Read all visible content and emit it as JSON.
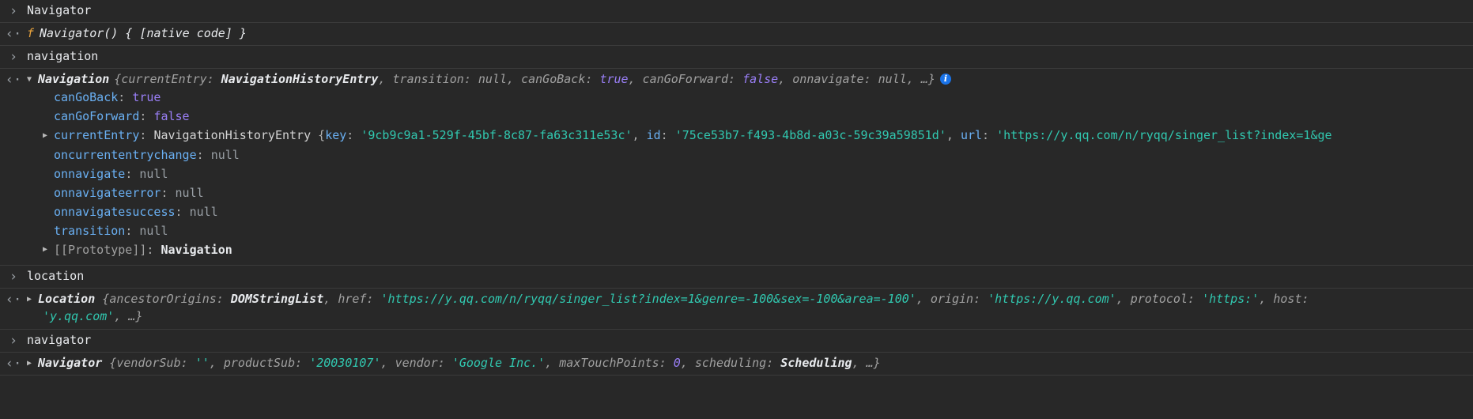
{
  "console": {
    "prompt_glyph": "›",
    "result_glyph": "‹·",
    "colors": {
      "background": "#282828",
      "divider": "#3b3b3b",
      "text": "#d4d4d4",
      "property_name": "#6ab0f3",
      "string": "#31c8b0",
      "boolean_number": "#9a7ff7",
      "null_undefined": "#a1a1a1",
      "function_keyword": "#e8a33d",
      "info_badge": "#1a73e8"
    },
    "entries": [
      {
        "type": "input",
        "text": "Navigator"
      },
      {
        "type": "output",
        "fn_keyword": "f",
        "fn_body": "Navigator() { [native code] }"
      },
      {
        "type": "input",
        "text": "navigation"
      },
      {
        "type": "output_expanded",
        "class_name": "Navigation",
        "preview_open": "{",
        "preview_props": [
          {
            "name": "currentEntry",
            "sep": ": ",
            "value": "NavigationHistoryEntry",
            "value_kind": "classname"
          },
          {
            "name": "transition",
            "sep": ": ",
            "value": "null",
            "value_kind": "null"
          },
          {
            "name": "canGoBack",
            "sep": ": ",
            "value": "true",
            "value_kind": "bool"
          },
          {
            "name": "canGoForward",
            "sep": ": ",
            "value": "false",
            "value_kind": "bool"
          },
          {
            "name": "onnavigate",
            "sep": ": ",
            "value": "null",
            "value_kind": "null"
          }
        ],
        "preview_ellipsis": ", …}",
        "info_badge_label": "i",
        "properties": [
          {
            "indent": 1,
            "triangle": "",
            "name": "canGoBack",
            "value": "true",
            "kind": "bool"
          },
          {
            "indent": 1,
            "triangle": "",
            "name": "canGoForward",
            "value": "false",
            "kind": "bool"
          },
          {
            "indent": 0,
            "triangle": "right",
            "name": "currentEntry",
            "kind": "object-preview",
            "class_name": "NavigationHistoryEntry",
            "inline_parts": [
              {
                "t": "punct",
                "v": " {"
              },
              {
                "t": "propname",
                "v": "key"
              },
              {
                "t": "punct",
                "v": ": "
              },
              {
                "t": "string",
                "v": "'9cb9c9a1-529f-45bf-8c87-fa63c311e53c'"
              },
              {
                "t": "punct",
                "v": ", "
              },
              {
                "t": "propname",
                "v": "id"
              },
              {
                "t": "punct",
                "v": ": "
              },
              {
                "t": "string",
                "v": "'75ce53b7-f493-4b8d-a03c-59c39a59851d'"
              },
              {
                "t": "punct",
                "v": ", "
              },
              {
                "t": "propname",
                "v": "url"
              },
              {
                "t": "punct",
                "v": ": "
              },
              {
                "t": "string",
                "v": "'https://y.qq.com/n/ryqq/singer_list?index=1&ge"
              }
            ]
          },
          {
            "indent": 1,
            "triangle": "",
            "name": "oncurrententrychange",
            "value": "null",
            "kind": "null"
          },
          {
            "indent": 1,
            "triangle": "",
            "name": "onnavigate",
            "value": "null",
            "kind": "null"
          },
          {
            "indent": 1,
            "triangle": "",
            "name": "onnavigateerror",
            "value": "null",
            "kind": "null"
          },
          {
            "indent": 1,
            "triangle": "",
            "name": "onnavigatesuccess",
            "value": "null",
            "kind": "null"
          },
          {
            "indent": 1,
            "triangle": "",
            "name": "transition",
            "value": "null",
            "kind": "null"
          },
          {
            "indent": 0,
            "triangle": "right",
            "name": "[[Prototype]]",
            "value": "Navigation",
            "kind": "proto"
          }
        ]
      },
      {
        "type": "input",
        "text": "location"
      },
      {
        "type": "output_location",
        "class_name": "Location",
        "line1": [
          {
            "t": "punct",
            "v": " {"
          },
          {
            "t": "prop",
            "v": "ancestorOrigins"
          },
          {
            "t": "punct",
            "v": ": "
          },
          {
            "t": "classname",
            "v": "DOMStringList"
          },
          {
            "t": "punct",
            "v": ", "
          },
          {
            "t": "prop",
            "v": "href"
          },
          {
            "t": "punct",
            "v": ": "
          },
          {
            "t": "string-i",
            "v": "'https://y.qq.com/n/ryqq/singer_list?index=1&genre=-100&sex=-100&area=-100'"
          },
          {
            "t": "punct",
            "v": ", "
          },
          {
            "t": "prop",
            "v": "origin"
          },
          {
            "t": "punct",
            "v": ": "
          },
          {
            "t": "string-i",
            "v": "'https://y.qq.com'"
          },
          {
            "t": "punct",
            "v": ", "
          },
          {
            "t": "prop",
            "v": "protocol"
          },
          {
            "t": "punct",
            "v": ": "
          },
          {
            "t": "string-i",
            "v": "'https:'"
          },
          {
            "t": "punct",
            "v": ", "
          },
          {
            "t": "prop",
            "v": "host"
          },
          {
            "t": "punct",
            "v": ":"
          }
        ],
        "line2": [
          {
            "t": "string-i",
            "v": "'y.qq.com'"
          },
          {
            "t": "punct",
            "v": ", …}"
          }
        ]
      },
      {
        "type": "input",
        "text": "navigator"
      },
      {
        "type": "output_navigator",
        "class_name": "Navigator",
        "parts": [
          {
            "t": "punct",
            "v": " {"
          },
          {
            "t": "prop",
            "v": "vendorSub"
          },
          {
            "t": "punct",
            "v": ": "
          },
          {
            "t": "string-i",
            "v": "''"
          },
          {
            "t": "punct",
            "v": ", "
          },
          {
            "t": "prop",
            "v": "productSub"
          },
          {
            "t": "punct",
            "v": ": "
          },
          {
            "t": "string-i",
            "v": "'20030107'"
          },
          {
            "t": "punct",
            "v": ", "
          },
          {
            "t": "prop",
            "v": "vendor"
          },
          {
            "t": "punct",
            "v": ": "
          },
          {
            "t": "string-i",
            "v": "'Google Inc.'"
          },
          {
            "t": "punct",
            "v": ", "
          },
          {
            "t": "prop",
            "v": "maxTouchPoints"
          },
          {
            "t": "punct",
            "v": ": "
          },
          {
            "t": "num",
            "v": "0"
          },
          {
            "t": "punct",
            "v": ", "
          },
          {
            "t": "prop",
            "v": "scheduling"
          },
          {
            "t": "punct",
            "v": ": "
          },
          {
            "t": "classname",
            "v": "Scheduling"
          },
          {
            "t": "punct",
            "v": ", …}"
          }
        ]
      }
    ]
  }
}
